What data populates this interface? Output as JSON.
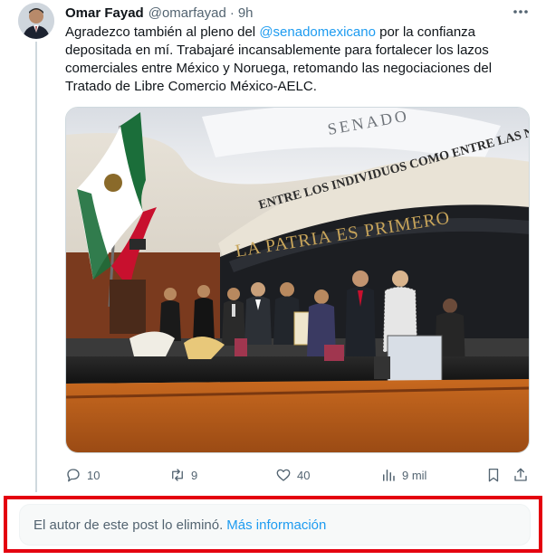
{
  "tweet": {
    "author_name": "Omar Fayad",
    "handle": "@omarfayad",
    "separator": "·",
    "time": "9h",
    "text_before": "Agradezco también al pleno del ",
    "mention": "@senadomexicano",
    "text_after": " por la confianza depositada en mí. Trabajaré incansablemente para fortalecer los lazos comerciales entre México y Noruega, retomando las negociaciones del Tratado de Libre Comercio México-AELC."
  },
  "media": {
    "sign_top": "SENADO",
    "banner_line": "ENTRE LOS INDIVIDUOS COMO ENTRE LAS NA",
    "motto": "LA PATRIA ES PRIMERO"
  },
  "actions": {
    "replies": "10",
    "reposts": "9",
    "likes": "40",
    "views": "9 mil"
  },
  "notice": {
    "message": "El autor de este post lo eliminó.",
    "link": "Más información"
  },
  "colors": {
    "accent": "#1d9bf0",
    "secondary_text": "#536471",
    "highlight_frame": "#e4000f"
  }
}
